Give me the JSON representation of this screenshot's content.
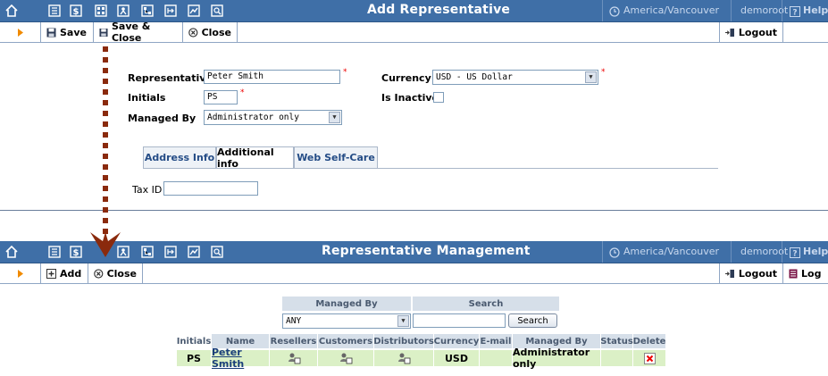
{
  "top": {
    "title": "Add Representative",
    "timezone": "America/Vancouver",
    "user": "demoroot",
    "help": "Help",
    "actions": {
      "save": "Save",
      "save_close": "Save & Close",
      "close": "Close",
      "logout": "Logout"
    },
    "form": {
      "representative_label": "Representative",
      "representative_value": "Peter Smith",
      "initials_label": "Initials",
      "initials_value": "PS",
      "managed_by_label": "Managed By",
      "managed_by_value": "Administrator only",
      "currency_label": "Currency",
      "currency_value": "USD - US Dollar",
      "inactive_label": "Is Inactive",
      "required_mark": "*"
    },
    "tabs": [
      {
        "label": "Address Info"
      },
      {
        "label": "Additional info"
      },
      {
        "label": "Web Self-Care"
      }
    ],
    "tax_id_label": "Tax ID",
    "tax_id_value": ""
  },
  "bottom": {
    "title": "Representative Management",
    "timezone": "America/Vancouver",
    "user": "demoroot",
    "help": "Help",
    "actions": {
      "add": "Add",
      "close": "Close",
      "logout": "Logout",
      "log": "Log"
    },
    "filter": {
      "managed_by_header": "Managed By",
      "search_header": "Search",
      "managed_by_value": "ANY",
      "search_value": "",
      "search_button": "Search"
    },
    "table": {
      "headers": [
        "Initials",
        "Name",
        "Resellers",
        "Customers",
        "Distributors",
        "Currency",
        "E-mail",
        "Managed By",
        "Status",
        "Delete"
      ],
      "row": {
        "initials": "PS",
        "name": "Peter Smith",
        "currency": "USD",
        "email": "",
        "managed_by": "Administrator only",
        "status": ""
      }
    }
  }
}
